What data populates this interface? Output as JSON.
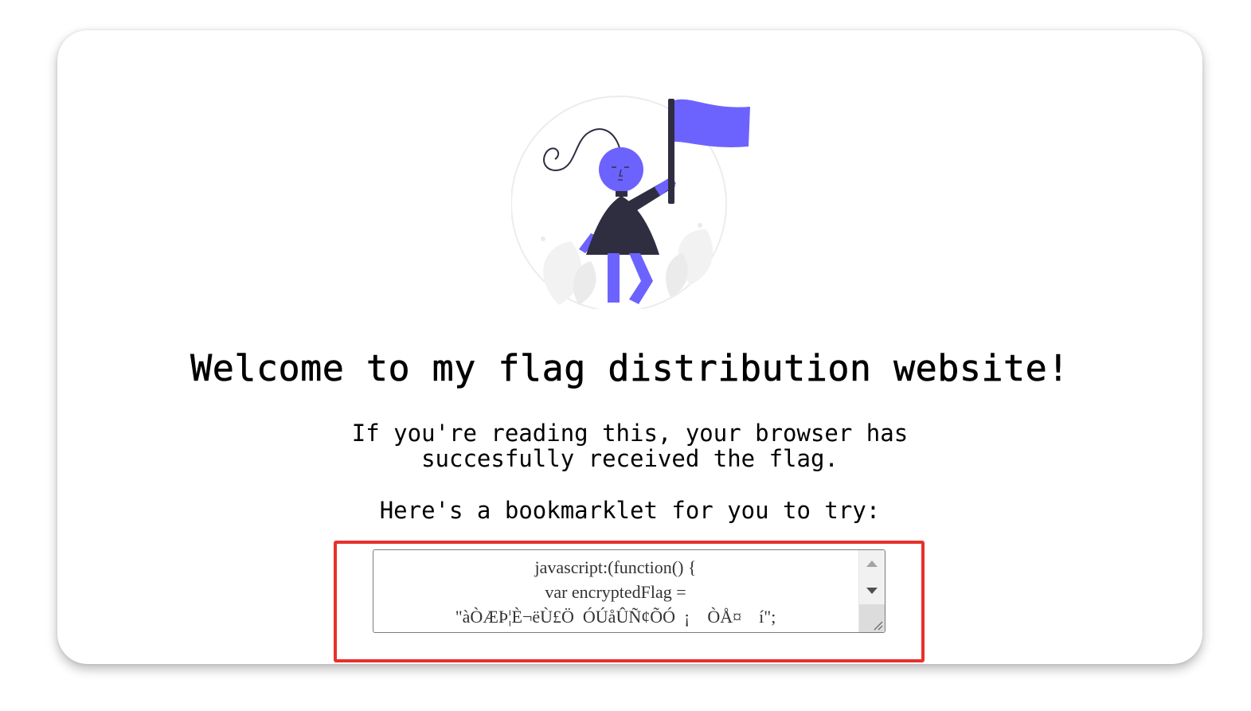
{
  "page": {
    "title": "Welcome to my flag distribution website!",
    "subtitle_lines": [
      "If you're reading this, your browser has",
      "succesfully received the flag."
    ],
    "bookmarklet_prompt": "Here's a bookmarklet for you to try:"
  },
  "bookmarklet": {
    "code_lines": [
      "javascript:(function() {",
      "var encryptedFlag =",
      "\"àÒÆÞ¦È¬ëÙ£Ö  ÓÚåÛÑ¢ÕÓ  ¡    ÒÅ¤    í\";"
    ]
  },
  "colors": {
    "accent": "#6c63ff",
    "figure_dark": "#2f2e41",
    "highlight_border": "#e8302c"
  },
  "icons": {
    "illustration": "woman-holding-flag-illustration",
    "scroll_up": "scroll-up-arrow-icon",
    "scroll_down": "scroll-down-arrow-icon",
    "resize": "resize-grip-icon"
  }
}
